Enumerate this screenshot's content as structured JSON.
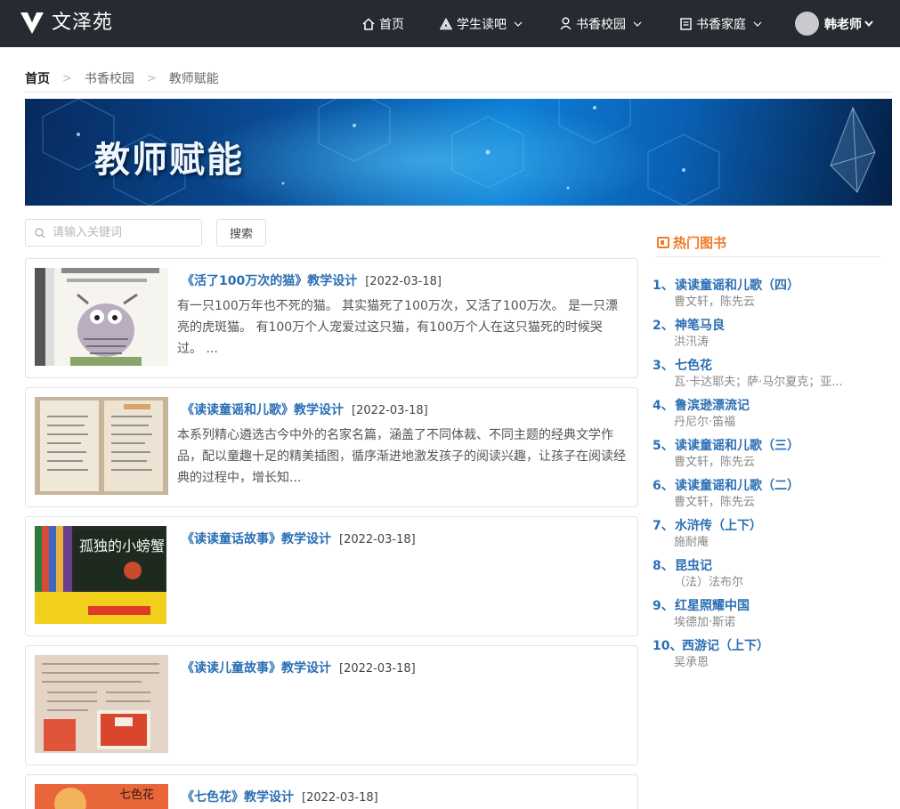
{
  "app": {
    "logo_text": "文泽苑"
  },
  "nav": {
    "items": [
      {
        "label": "首页",
        "icon": "home-icon"
      },
      {
        "label": "学生读吧",
        "icon": "triangle-logo-icon"
      },
      {
        "label": "书香校园",
        "icon": "user-icon"
      },
      {
        "label": "书香家庭",
        "icon": "book-icon"
      }
    ],
    "user_name": "韩老师"
  },
  "breadcrumb": [
    "首页",
    "书香校园",
    "教师赋能"
  ],
  "banner": {
    "title": "教师赋能"
  },
  "search": {
    "placeholder": "请输入关键词",
    "value": "",
    "button_label": "搜索"
  },
  "articles": [
    {
      "title": "《活了100万次的猫》教学设计",
      "date": "[2022-03-18]",
      "desc": "有一只100万年也不死的猫。 其实猫死了100万次，又活了100万次。 是一只漂亮的虎斑猫。 有100万个人宠爱过这只猫，有100万个人在这只猫死的时候哭过。 ...",
      "thumb": "cat-book-cover"
    },
    {
      "title": "《读读童谣和儿歌》教学设计",
      "date": "[2022-03-18]",
      "desc": "本系列精心遴选古今中外的名家名篇，涵盖了不同体裁、不同主题的经典文学作品，配以童趣十足的精美插图，循序渐进地激发孩子的阅读兴趣，让孩子在阅读经典的过程中，增长知...",
      "thumb": "open-book-pages"
    },
    {
      "title": "《读读童话故事》教学设计",
      "date": "[2022-03-18]",
      "desc": "",
      "thumb": "book-box-set"
    },
    {
      "title": "《读读儿童故事》教学设计",
      "date": "[2022-03-18]",
      "desc": "",
      "thumb": "worksheet-photo"
    },
    {
      "title": "《七色花》教学设计",
      "date": "[2022-03-18]",
      "desc": "",
      "thumb": "seven-color-flower-cover"
    }
  ],
  "hot_books": {
    "title": "热门图书",
    "items": [
      {
        "num": "1、",
        "title": "读读童谣和儿歌（四）",
        "author": "曹文轩，陈先云"
      },
      {
        "num": "2、",
        "title": "神笔马良",
        "author": "洪汛涛"
      },
      {
        "num": "3、",
        "title": "七色花",
        "author": "瓦·卡达耶夫；萨·马尔夏克；亚..."
      },
      {
        "num": "4、",
        "title": "鲁滨逊漂流记",
        "author": "丹尼尔·笛福"
      },
      {
        "num": "5、",
        "title": "读读童谣和儿歌（三）",
        "author": "曹文轩，陈先云"
      },
      {
        "num": "6、",
        "title": "读读童谣和儿歌（二）",
        "author": "曹文轩，陈先云"
      },
      {
        "num": "7、",
        "title": "水浒传（上下）",
        "author": "施耐庵"
      },
      {
        "num": "8、",
        "title": "昆虫记",
        "author": "（法）法布尔"
      },
      {
        "num": "9、",
        "title": "红星照耀中国",
        "author": "埃德加·斯诺"
      },
      {
        "num": "10、",
        "title": "西游记（上下）",
        "author": "吴承恩"
      }
    ]
  },
  "colors": {
    "topbar_bg": "#262a31",
    "link_blue": "#2a6fb5",
    "hot_orange": "#f07a2b"
  }
}
